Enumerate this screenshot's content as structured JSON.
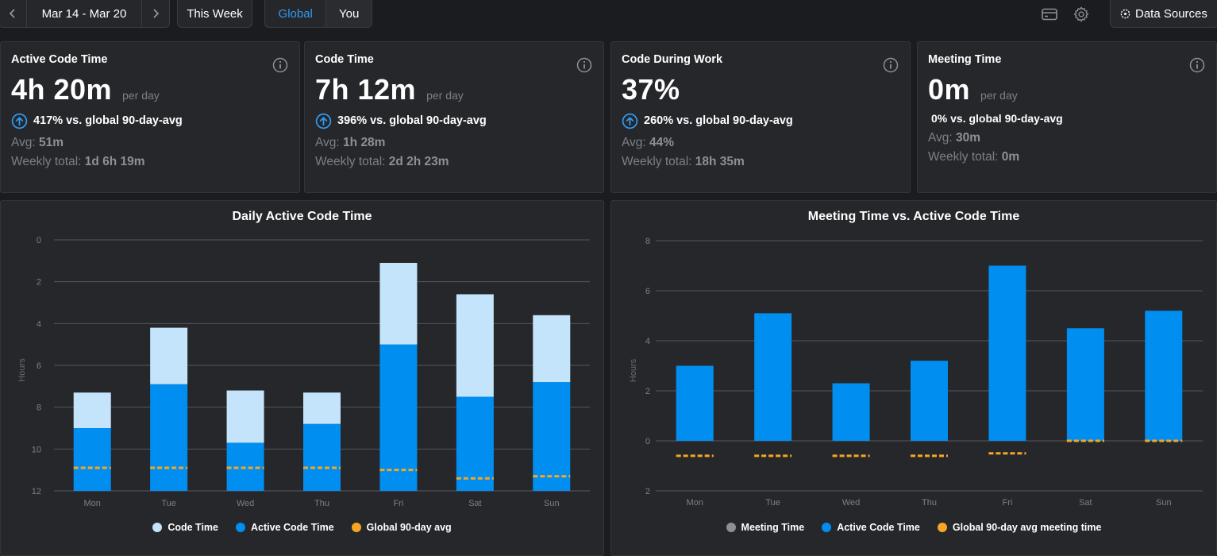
{
  "topbar": {
    "date_range": "Mar 14 - Mar 20",
    "this_week": "This Week",
    "scope_tabs": [
      "Global",
      "You"
    ],
    "active_scope": "Global",
    "data_sources": "Data Sources",
    "icons": [
      "chevron-left-icon",
      "chevron-right-icon",
      "billing-card-icon",
      "gear-icon",
      "data-sources-icon"
    ]
  },
  "cards": [
    {
      "title": "Active Code Time",
      "value": "4h 20m",
      "per": "per day",
      "compare": "417% vs. global 90-day-avg",
      "arrow": true,
      "avg_label": "Avg: ",
      "avg": "51m",
      "weekly_label": "Weekly total: ",
      "weekly": "1d 6h 19m"
    },
    {
      "title": "Code Time",
      "value": "7h 12m",
      "per": "per day",
      "compare": "396% vs. global 90-day-avg",
      "arrow": true,
      "avg_label": "Avg: ",
      "avg": "1h 28m",
      "weekly_label": "Weekly total: ",
      "weekly": "2d 2h 23m"
    },
    {
      "title": "Code During Work",
      "value": "37%",
      "per": "",
      "compare": "260% vs. global 90-day-avg",
      "arrow": true,
      "avg_label": "Avg: ",
      "avg": "44%",
      "weekly_label": "Weekly total: ",
      "weekly": "18h 35m"
    },
    {
      "title": "Meeting Time",
      "value": "0m",
      "per": "per day",
      "compare": "0% vs. global 90-day-avg",
      "arrow": false,
      "avg_label": "Avg: ",
      "avg": "30m",
      "weekly_label": "Weekly total: ",
      "weekly": "0m"
    }
  ],
  "colors": {
    "code_time": "#c4e4fb",
    "active_code_time": "#008ef1",
    "global_avg": "#f5a623",
    "meeting_time": "#8e8e93",
    "accent_blue": "#2f9bf0"
  },
  "chart_data": [
    {
      "type": "bar",
      "title": "Daily Active Code Time",
      "ylabel": "Hours",
      "ylim": [
        0,
        12
      ],
      "yticks": [
        0,
        2,
        4,
        6,
        8,
        10,
        12
      ],
      "categories": [
        "Mon",
        "Tue",
        "Wed",
        "Thu",
        "Fri",
        "Sat",
        "Sun"
      ],
      "stacked": true,
      "series": [
        {
          "name": "Active Code Time",
          "values": [
            3.0,
            5.1,
            2.3,
            3.2,
            7.0,
            4.5,
            5.2
          ]
        },
        {
          "name": "Code Time",
          "values": [
            4.7,
            7.8,
            4.8,
            4.7,
            10.9,
            9.4,
            8.4
          ]
        },
        {
          "name": "Global 90-day avg",
          "style": "dashed-line",
          "values": [
            1.1,
            1.1,
            1.1,
            1.1,
            1.0,
            0.6,
            0.7
          ]
        }
      ],
      "legend": [
        "Code Time",
        "Active Code Time",
        "Global 90-day avg"
      ],
      "legend_position": "bottom",
      "grid": true
    },
    {
      "type": "bar",
      "title": "Meeting Time vs. Active Code Time",
      "ylabel": "Hours",
      "ylim": [
        -2,
        8
      ],
      "yticks": [
        8,
        6,
        4,
        2,
        0,
        2
      ],
      "categories": [
        "Mon",
        "Tue",
        "Wed",
        "Thu",
        "Fri",
        "Sat",
        "Sun"
      ],
      "series": [
        {
          "name": "Active Code Time",
          "values": [
            3.0,
            5.1,
            2.3,
            3.2,
            7.0,
            4.5,
            5.2
          ]
        },
        {
          "name": "Meeting Time",
          "values": [
            0,
            0,
            0,
            0,
            0,
            0,
            0
          ]
        },
        {
          "name": "Global 90-day avg meeting time",
          "style": "dashed-line",
          "values": [
            -0.6,
            -0.6,
            -0.6,
            -0.6,
            -0.5,
            0,
            0
          ]
        }
      ],
      "legend": [
        "Meeting Time",
        "Active Code Time",
        "Global 90-day avg meeting time"
      ],
      "legend_position": "bottom",
      "grid": true
    }
  ]
}
